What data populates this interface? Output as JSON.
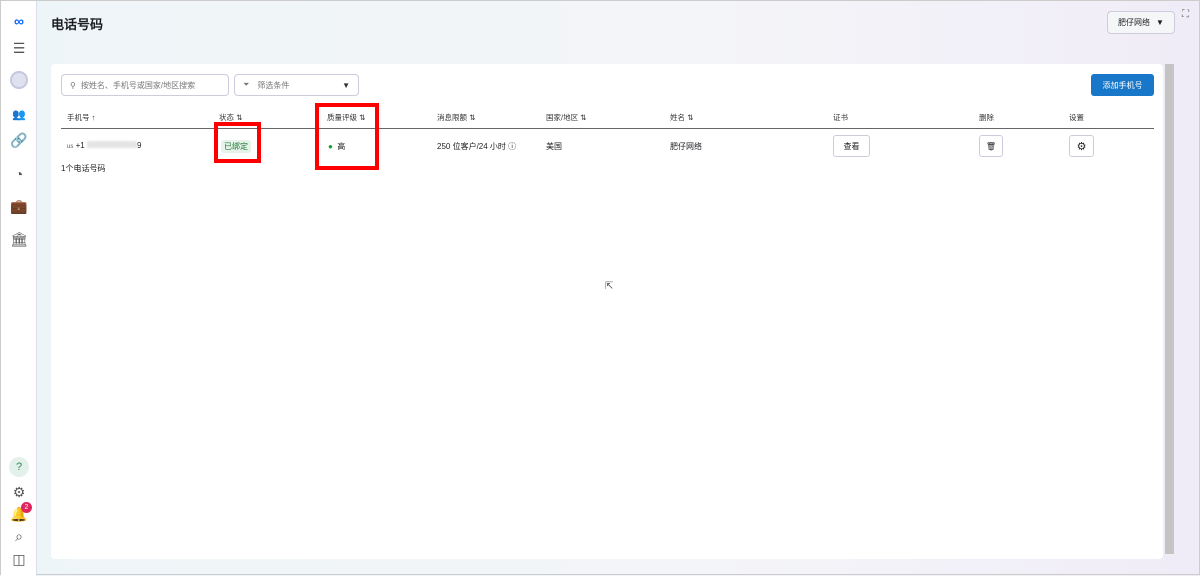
{
  "header": {
    "title": "电话号码",
    "account": "肥仔网络"
  },
  "toolbar": {
    "search_placeholder": "按姓名、手机号或国家/地区搜索",
    "filter_label": "筛选条件",
    "add_button": "添加手机号"
  },
  "table": {
    "columns": [
      "手机号",
      "状态",
      "质量评级",
      "消息限额",
      "国家/地区",
      "姓名",
      "证书",
      "删除",
      "设置"
    ],
    "rows": [
      {
        "country_code": "us",
        "phone_prefix": "+1",
        "phone_suffix": "9",
        "status": "已绑定",
        "quality": "高",
        "quality_color": "#1a9e2e",
        "limit": "250 位客户/24 小时",
        "country": "美国",
        "name": "肥仔网络",
        "cert_button": "查看"
      }
    ],
    "count": "1个电话号码"
  },
  "sidebar": {
    "notification_count": "2"
  }
}
